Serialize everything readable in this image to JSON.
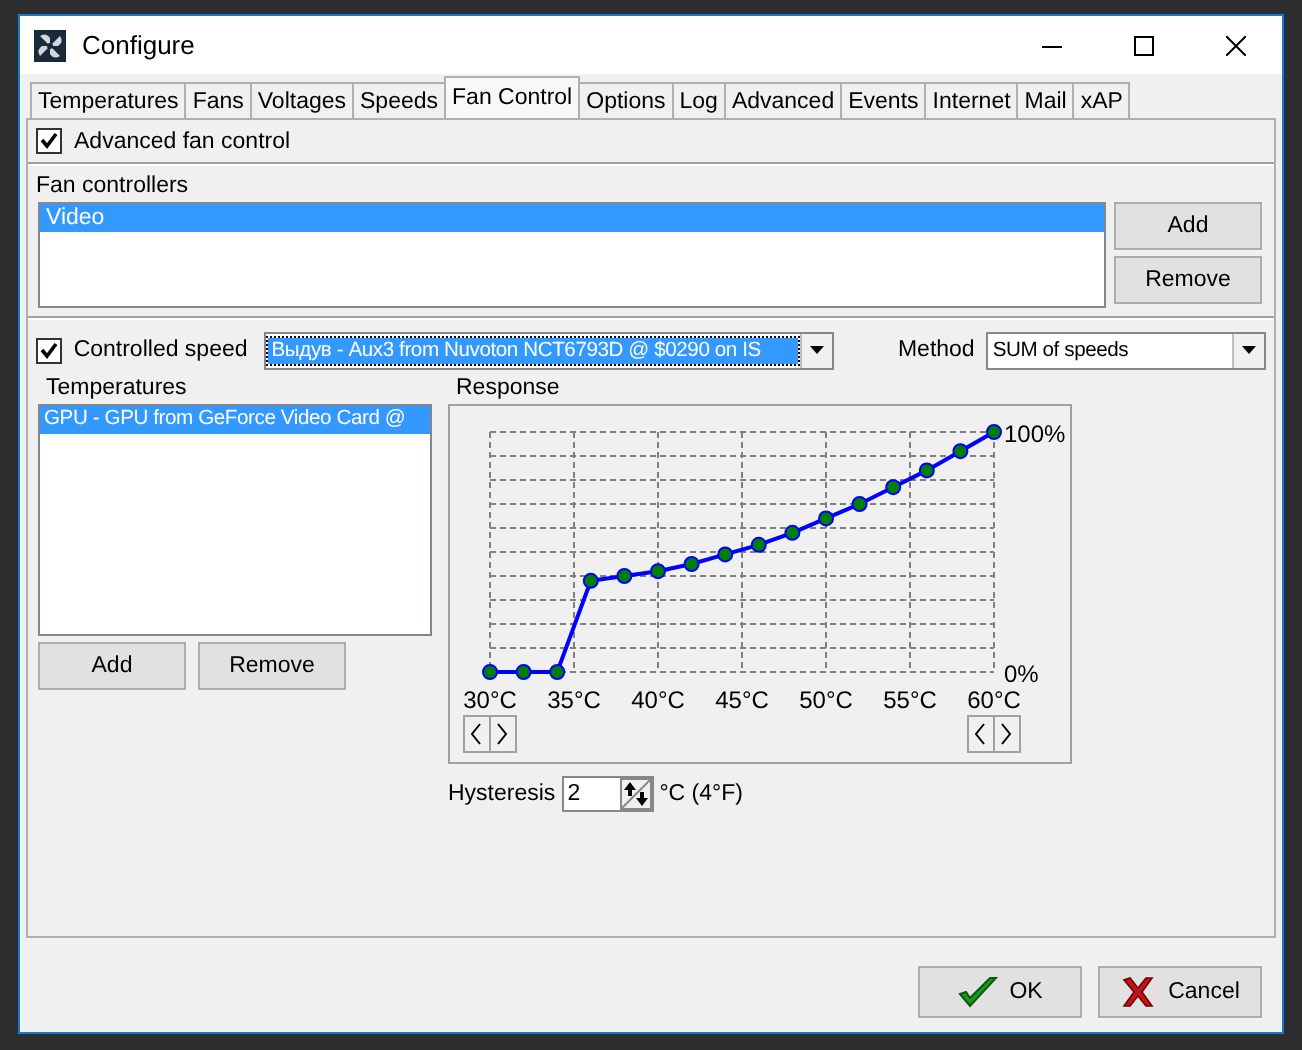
{
  "window": {
    "title": "Configure"
  },
  "tabs": [
    {
      "label": "Temperatures",
      "selected": false
    },
    {
      "label": "Fans",
      "selected": false
    },
    {
      "label": "Voltages",
      "selected": false
    },
    {
      "label": "Speeds",
      "selected": false
    },
    {
      "label": "Fan Control",
      "selected": true
    },
    {
      "label": "Options",
      "selected": false
    },
    {
      "label": "Log",
      "selected": false
    },
    {
      "label": "Advanced",
      "selected": false
    },
    {
      "label": "Events",
      "selected": false
    },
    {
      "label": "Internet",
      "selected": false
    },
    {
      "label": "Mail",
      "selected": false
    },
    {
      "label": "xAP",
      "selected": false
    }
  ],
  "advanced_fan_control": {
    "label": "Advanced fan control",
    "checked": true
  },
  "fan_controllers": {
    "label": "Fan controllers",
    "items": [
      {
        "label": "Video",
        "selected": true
      }
    ],
    "buttons": [
      "Add",
      "Remove"
    ]
  },
  "controlled_speed": {
    "label": "Controlled speed",
    "checked": true,
    "value": "Выдув - Aux3 from Nuvoton NCT6793D @ $0290 on IS"
  },
  "method": {
    "label": "Method",
    "value": "SUM of speeds"
  },
  "temperatures": {
    "label": "Temperatures",
    "items": [
      {
        "label": "GPU - GPU from GeForce Video Card @",
        "selected": true
      }
    ],
    "buttons": [
      "Add",
      "Remove"
    ]
  },
  "response": {
    "chart_data": {
      "type": "line",
      "title": "Response",
      "grid": true,
      "x": [
        30,
        32,
        34,
        36,
        38,
        40,
        42,
        44,
        46,
        48,
        50,
        52,
        54,
        56,
        58,
        60
      ],
      "series": [
        {
          "color": "#0000ff",
          "marker": "o",
          "values": [
            0,
            0,
            0,
            38,
            40,
            42,
            45,
            49,
            53,
            58,
            64,
            70,
            77,
            84,
            92,
            100
          ]
        }
      ],
      "xlim": [
        30,
        60
      ],
      "ylim": [
        0,
        100
      ],
      "xticks": [
        {
          "value": 30,
          "label": "30°C"
        },
        {
          "value": 35,
          "label": "35°C"
        },
        {
          "value": 40,
          "label": "40°C"
        },
        {
          "value": 45,
          "label": "45°C"
        },
        {
          "value": 50,
          "label": "50°C"
        },
        {
          "value": 55,
          "label": "55°C"
        },
        {
          "value": 60,
          "label": "60°C"
        }
      ],
      "yticks": [
        {
          "value": 0,
          "label": "0%"
        },
        {
          "value": 100,
          "label": "100%"
        }
      ]
    }
  },
  "hysteresis": {
    "label": "Hysteresis",
    "value": "2",
    "unit": "°C (4°F)"
  },
  "buttons": [
    {
      "kind": "ok",
      "label": "OK"
    },
    {
      "kind": "cancel",
      "label": "Cancel"
    }
  ]
}
